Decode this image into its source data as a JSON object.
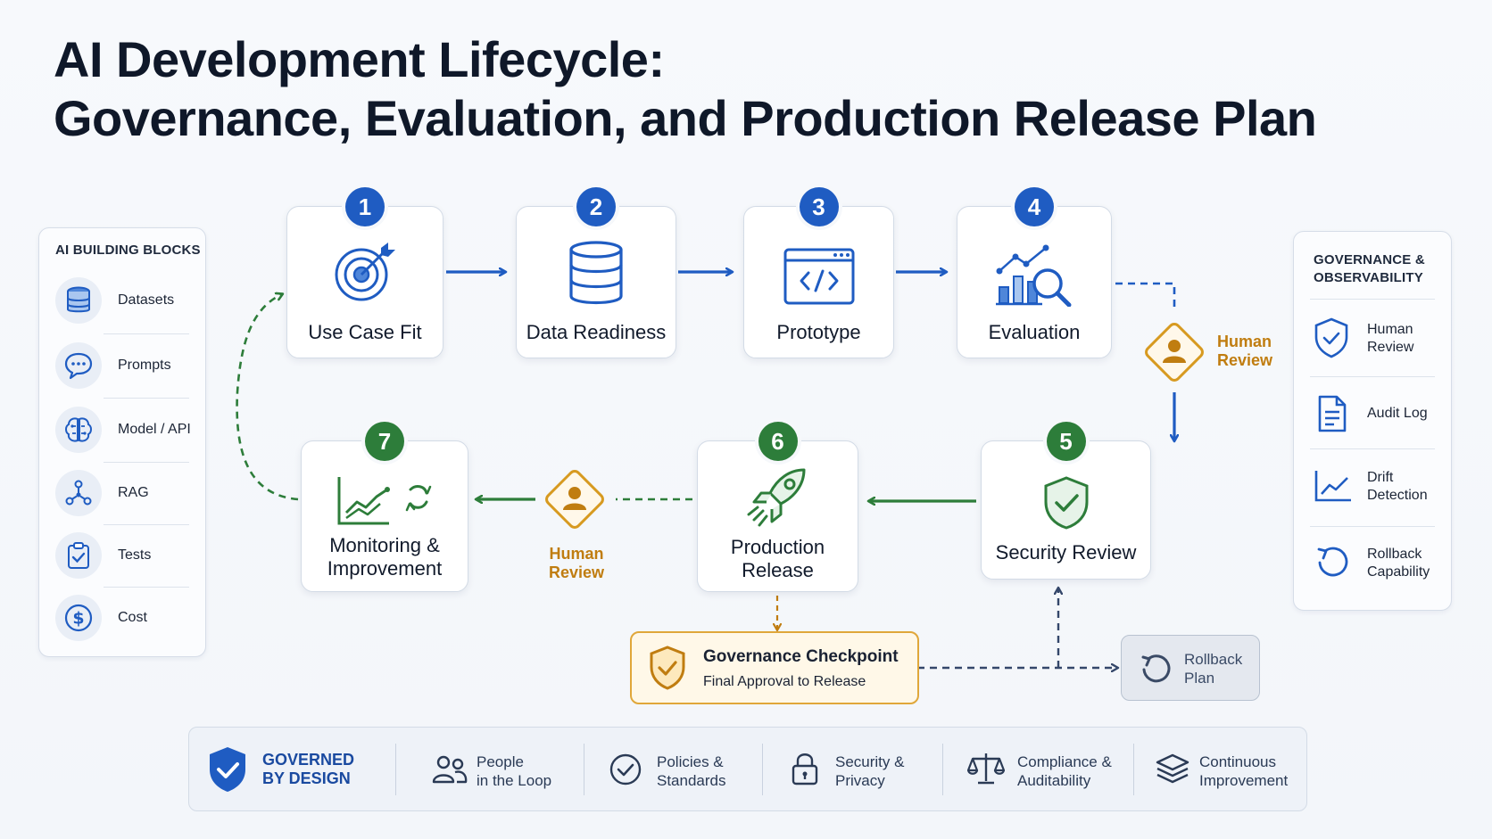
{
  "title": {
    "line1": "AI Development Lifecycle:",
    "line2": "Governance, Evaluation, and Production Release Plan"
  },
  "building_blocks": {
    "heading": "AI BUILDING BLOCKS",
    "items": [
      {
        "label": "Datasets",
        "icon": "database-icon"
      },
      {
        "label": "Prompts",
        "icon": "chat-bubble-icon"
      },
      {
        "label": "Model / API",
        "icon": "brain-icon"
      },
      {
        "label": "RAG",
        "icon": "network-icon"
      },
      {
        "label": "Tests",
        "icon": "clipboard-check-icon"
      },
      {
        "label": "Cost",
        "icon": "dollar-icon"
      }
    ]
  },
  "steps": [
    {
      "number": "1",
      "label": "Use Case Fit",
      "icon": "target-icon"
    },
    {
      "number": "2",
      "label": "Data Readiness",
      "icon": "database-icon"
    },
    {
      "number": "3",
      "label": "Prototype",
      "icon": "code-window-icon"
    },
    {
      "number": "4",
      "label": "Evaluation",
      "icon": "chart-magnifier-icon"
    },
    {
      "number": "5",
      "label": "Security Review",
      "icon": "shield-check-icon"
    },
    {
      "number": "6",
      "label_line1": "Production",
      "label_line2": "Release",
      "icon": "rocket-icon"
    },
    {
      "number": "7",
      "label_line1": "Monitoring &",
      "label_line2": "Improvement",
      "icon": "trend-refresh-icon"
    }
  ],
  "human_review": {
    "line1": "Human",
    "line2": "Review"
  },
  "governance_checkpoint": {
    "title": "Governance Checkpoint",
    "subtitle": "Final Approval to Release"
  },
  "rollback_plan": {
    "line1": "Rollback",
    "line2": "Plan"
  },
  "governance_panel": {
    "heading_line1": "GOVERNANCE &",
    "heading_line2": "OBSERVABILITY",
    "items": [
      {
        "line1": "Human",
        "line2": "Review",
        "icon": "shield-check-icon"
      },
      {
        "line1": "Audit Log",
        "line2": "",
        "icon": "document-icon"
      },
      {
        "line1": "Drift",
        "line2": "Detection",
        "icon": "line-chart-icon"
      },
      {
        "line1": "Rollback",
        "line2": "Capability",
        "icon": "undo-icon"
      }
    ]
  },
  "footer": {
    "governed_line1": "GOVERNED",
    "governed_line2": "BY DESIGN",
    "items": [
      {
        "line1": "People",
        "line2": "in the Loop",
        "icon": "people-icon"
      },
      {
        "line1": "Policies &",
        "line2": "Standards",
        "icon": "check-circle-icon"
      },
      {
        "line1": "Security &",
        "line2": "Privacy",
        "icon": "lock-icon"
      },
      {
        "line1": "Compliance &",
        "line2": "Auditability",
        "icon": "scales-icon"
      },
      {
        "line1": "Continuous",
        "line2": "Improvement",
        "icon": "layers-icon"
      }
    ]
  },
  "colors": {
    "primary_blue": "#1f5cc2",
    "green": "#2d7d3a",
    "amber": "#c07d10",
    "navy": "#34476a"
  }
}
